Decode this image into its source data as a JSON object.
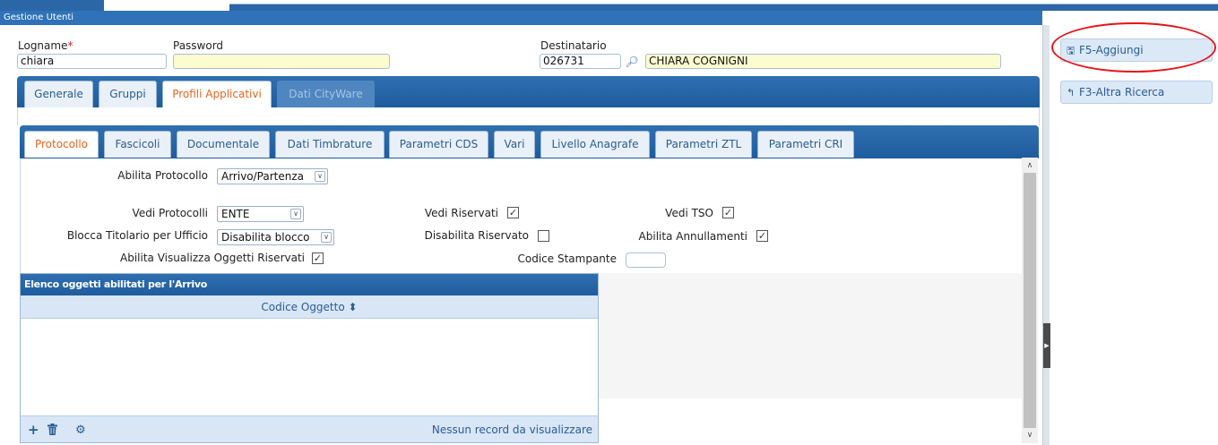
{
  "window": {
    "title": "Gestione Utenti"
  },
  "header": {
    "logname_label": "Logname",
    "required_mark": "*",
    "logname_value": "chiara",
    "password_label": "Password",
    "password_value": "",
    "destinatario_label": "Destinatario",
    "destinatario_code": "026731",
    "destinatario_name": "CHIARA COGNIGNI"
  },
  "main_tabs": [
    {
      "label": "Generale"
    },
    {
      "label": "Gruppi"
    },
    {
      "label": "Profili Applicativi"
    },
    {
      "label": "Dati CityWare"
    }
  ],
  "sub_tabs": [
    {
      "label": "Protocollo"
    },
    {
      "label": "Fascicoli"
    },
    {
      "label": "Documentale"
    },
    {
      "label": "Dati Timbrature"
    },
    {
      "label": "Parametri CDS"
    },
    {
      "label": "Vari"
    },
    {
      "label": "Livello Anagrafe"
    },
    {
      "label": "Parametri ZTL"
    },
    {
      "label": "Parametri CRI"
    }
  ],
  "form": {
    "abilita_protocollo_label": "Abilita Protocollo",
    "abilita_protocollo_value": "Arrivo/Partenza",
    "vedi_protocolli_label": "Vedi Protocolli",
    "vedi_protocolli_value": "ENTE",
    "blocca_titolario_label": "Blocca Titolario per Ufficio",
    "blocca_titolario_value": "Disabilita blocco",
    "abilita_visualizza_label": "Abilita Visualizza Oggetti Riservati",
    "vedi_riservati_label": "Vedi Riservati",
    "disabilita_riservato_label": "Disabilita Riservato",
    "codice_stampante_label": "Codice Stampante",
    "codice_stampante_value": "",
    "vedi_tso_label": "Vedi TSO",
    "abilita_annullamenti_label": "Abilita Annullamenti",
    "checkbox_states": {
      "abilita_visualizza": true,
      "vedi_riservati": true,
      "disabilita_riservato": false,
      "vedi_tso": true,
      "abilita_annullamenti": true
    }
  },
  "grid": {
    "title": "Elenco oggetti abilitati per l'Arrivo",
    "column": "Codice Oggetto",
    "sort_icon": "⬍",
    "empty_text": "Nessun record da visualizzare",
    "footer_icons": [
      "plus-icon",
      "trash-icon",
      "gear-icon"
    ]
  },
  "sidebar": {
    "buttons": [
      {
        "label": "F5-Aggiungi",
        "icon": "save-icon"
      },
      {
        "label": "F3-Altra Ricerca",
        "icon": "back-arrow-icon"
      }
    ]
  },
  "colors": {
    "accent_blue": "#2f6fb0",
    "active_tab_text": "#e8641c",
    "highlight_circle": "#e8101a",
    "yellow_field": "#fdfccf"
  }
}
